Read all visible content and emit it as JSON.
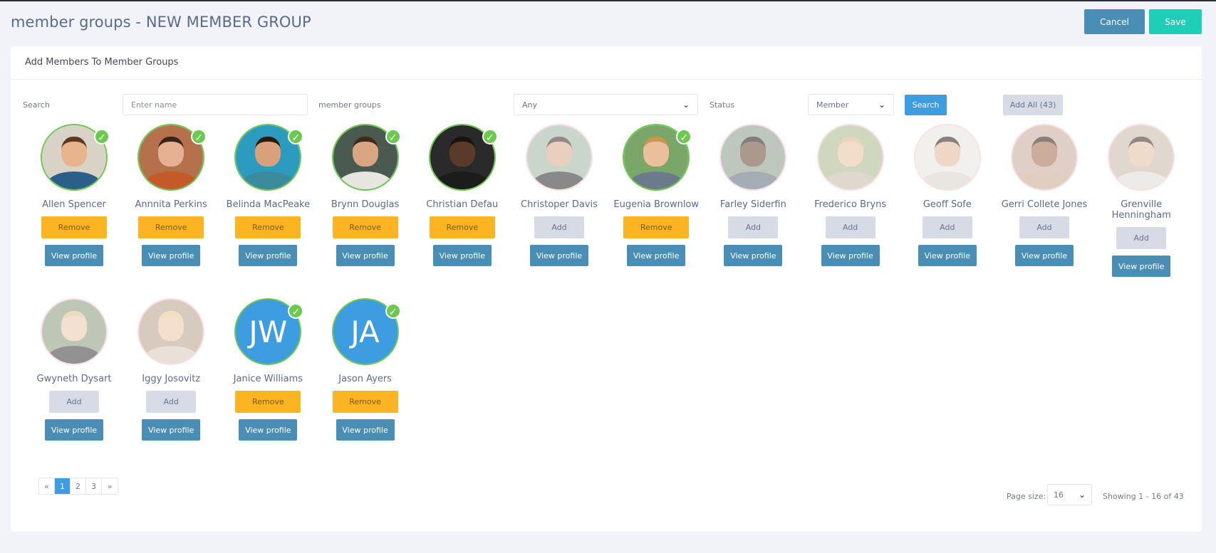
{
  "header": {
    "title": "member groups - NEW MEMBER GROUP",
    "cancel_label": "Cancel",
    "save_label": "Save"
  },
  "card": {
    "title": "Add Members To Member Groups"
  },
  "filters": {
    "search_label": "Search",
    "search_placeholder": "Enter name",
    "groups_label": "member groups",
    "groups_value": "Any",
    "status_label": "Status",
    "status_value": "Member",
    "search_button": "Search",
    "add_all_button": "Add All (43)"
  },
  "members": [
    {
      "name": "Allen Spencer",
      "selected": true,
      "action": "Remove",
      "view": "View profile",
      "skin": "#e8b48e",
      "hair": "#5a3a22",
      "shirt": "#2b5f8a",
      "bg": "#d9d2c6"
    },
    {
      "name": "Annnita Perkins",
      "selected": true,
      "action": "Remove",
      "view": "View profile",
      "skin": "#e6b193",
      "hair": "#3a2418",
      "shirt": "#c45a2a",
      "bg": "#b5714b"
    },
    {
      "name": "Belinda MacPeake",
      "selected": true,
      "action": "Remove",
      "view": "View profile",
      "skin": "#d9a07c",
      "hair": "#2a1a10",
      "shirt": "#3b8a9e",
      "bg": "#2d9bc0"
    },
    {
      "name": "Brynn Douglas",
      "selected": true,
      "action": "Remove",
      "view": "View profile",
      "skin": "#d9a684",
      "hair": "#3c2a1c",
      "shirt": "#e8e4df",
      "bg": "#4a5a50"
    },
    {
      "name": "Christian Defau",
      "selected": true,
      "action": "Remove",
      "view": "View profile",
      "skin": "#5a3b2a",
      "hair": "#1a1210",
      "shirt": "#1c1c1c",
      "bg": "#2a2a2a"
    },
    {
      "name": "Christoper Davis",
      "selected": false,
      "action": "Add",
      "view": "View profile",
      "skin": "#d6a88a",
      "hair": "#3a2c22",
      "shirt": "#2a2a2a",
      "bg": "#9fb4a4"
    },
    {
      "name": "Eugenia Brownlow",
      "selected": true,
      "action": "Remove",
      "view": "View profile",
      "skin": "#eabf9c",
      "hair": "#c9954f",
      "shirt": "#6b7b8c",
      "bg": "#7aa66a"
    },
    {
      "name": "Farley Siderfin",
      "selected": false,
      "action": "Add",
      "view": "View profile",
      "skin": "#6a4631",
      "hair": "#1c1410",
      "shirt": "#5a6a7a",
      "bg": "#8a9a8a"
    },
    {
      "name": "Frederico Bryns",
      "selected": false,
      "action": "Add",
      "view": "View profile",
      "skin": "#e8c2a2",
      "hair": "#d8b48a",
      "shirt": "#c8b8a8",
      "bg": "#a8b88a"
    },
    {
      "name": "Geoff Sofe",
      "selected": false,
      "action": "Add",
      "view": "View profile",
      "skin": "#e2b89a",
      "hair": "#2a1c14",
      "shirt": "#d8d0c8",
      "bg": "#e8e4e0"
    },
    {
      "name": "Gerri Collete Jones",
      "selected": false,
      "action": "Add",
      "view": "View profile",
      "skin": "#a46a48",
      "hair": "#2a1a12",
      "shirt": "#c8a890",
      "bg": "#c8a898"
    },
    {
      "name": "Grenville Henningham",
      "selected": false,
      "action": "Add",
      "view": "View profile",
      "skin": "#e2bea4",
      "hair": "#3a2a20",
      "shirt": "#e0dcd8",
      "bg": "#c8b8a8"
    },
    {
      "name": "Gwyneth Dysart",
      "selected": false,
      "action": "Add",
      "view": "View profile",
      "skin": "#ecc8ac",
      "hair": "#e0c090",
      "shirt": "#3a3a3a",
      "bg": "#8a9a7a"
    },
    {
      "name": "Iggy Josovitz",
      "selected": false,
      "action": "Add",
      "view": "View profile",
      "skin": "#ecc6a8",
      "hair": "#e4c890",
      "shirt": "#d8c8b8",
      "bg": "#b8a08a"
    },
    {
      "name": "Janice Williams",
      "selected": true,
      "action": "Remove",
      "view": "View profile",
      "initials": "JW"
    },
    {
      "name": "Jason Ayers",
      "selected": true,
      "action": "Remove",
      "view": "View profile",
      "initials": "JA"
    }
  ],
  "pagination": {
    "prev": "«",
    "pages": [
      "1",
      "2",
      "3"
    ],
    "next": "»",
    "current": "1",
    "page_size_label": "Page size:",
    "page_size": "16",
    "showing": "Showing 1 - 16 of 43"
  },
  "colors": {
    "accent": "#3d9de0",
    "save": "#1ecfb8",
    "cancel": "#4a8db5",
    "remove": "#fdb422",
    "add": "#d6dbe6",
    "selected_ring": "#6cc94f"
  }
}
